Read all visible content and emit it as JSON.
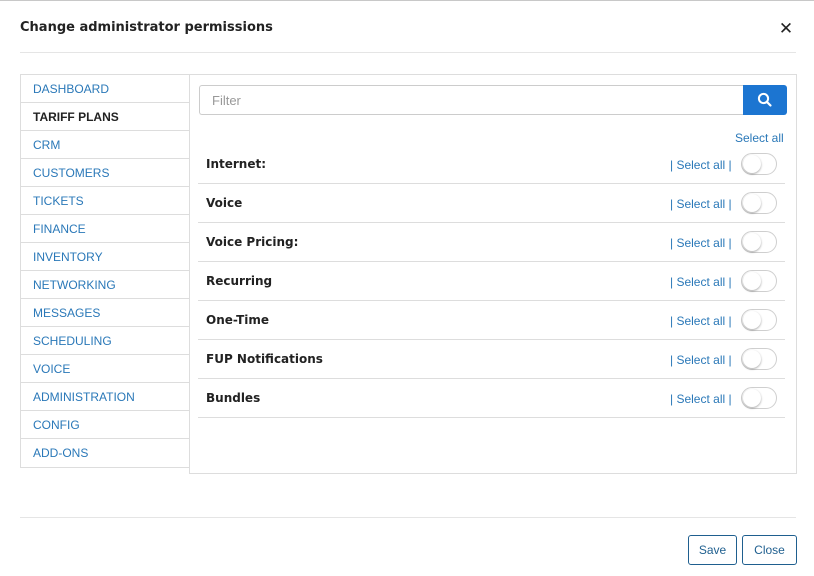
{
  "dialog": {
    "title": "Change administrator permissions",
    "close_glyph": "✕"
  },
  "sidebar": {
    "active_index": 1,
    "items": [
      {
        "label": "DASHBOARD"
      },
      {
        "label": "TARIFF PLANS"
      },
      {
        "label": "CRM"
      },
      {
        "label": "CUSTOMERS"
      },
      {
        "label": "TICKETS"
      },
      {
        "label": "FINANCE"
      },
      {
        "label": "INVENTORY"
      },
      {
        "label": "NETWORKING"
      },
      {
        "label": "MESSAGES"
      },
      {
        "label": "SCHEDULING"
      },
      {
        "label": "VOICE"
      },
      {
        "label": "ADMINISTRATION"
      },
      {
        "label": "CONFIG"
      },
      {
        "label": "ADD-ONS"
      }
    ]
  },
  "filter": {
    "placeholder": "Filter",
    "value": "",
    "search_icon": "search-icon"
  },
  "permissions": {
    "select_all_label": "Select all",
    "row_prefix": "| ",
    "row_select_label": "Select all",
    "row_suffix": " |",
    "rows": [
      {
        "label": "Internet:",
        "enabled": false
      },
      {
        "label": "Voice",
        "enabled": false
      },
      {
        "label": "Voice Pricing:",
        "enabled": false
      },
      {
        "label": "Recurring",
        "enabled": false
      },
      {
        "label": "One-Time",
        "enabled": false
      },
      {
        "label": "FUP Notifications",
        "enabled": false
      },
      {
        "label": "Bundles",
        "enabled": false
      }
    ]
  },
  "footer": {
    "save_label": "Save",
    "close_label": "Close"
  },
  "colors": {
    "link": "#2a78b8",
    "primary": "#1c75d1",
    "button_border": "#1f5f8f"
  }
}
